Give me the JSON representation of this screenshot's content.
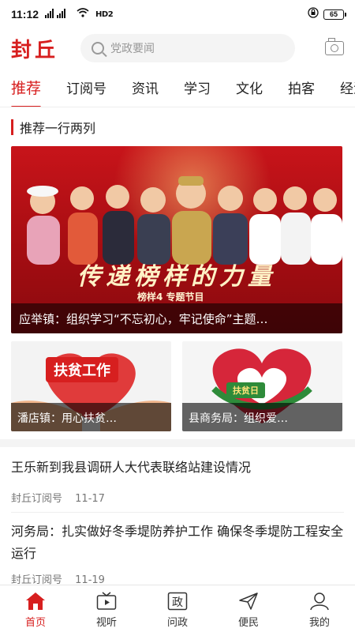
{
  "status_bar": {
    "time": "11:12",
    "signal_text": "HD2",
    "battery": "65"
  },
  "header": {
    "logo": "封丘",
    "search_placeholder": "党政要闻",
    "camera_icon": "camera-icon"
  },
  "tabs": [
    {
      "label": "推荐",
      "active": true
    },
    {
      "label": "订阅号",
      "active": false
    },
    {
      "label": "资讯",
      "active": false
    },
    {
      "label": "学习",
      "active": false
    },
    {
      "label": "文化",
      "active": false
    },
    {
      "label": "拍客",
      "active": false
    },
    {
      "label": "经济",
      "active": false
    }
  ],
  "section": {
    "title": "推荐一行两列"
  },
  "hero": {
    "calligraphy": "传递榜样的力量",
    "subtitle": "榜样4 专题节目",
    "caption": "应举镇：组织学习“不忘初心，牢记使命”主题…"
  },
  "cards": [
    {
      "badge": "扶贫工作",
      "caption": "潘店镇：用心扶贫…"
    },
    {
      "badge": "扶贫日",
      "caption": "县商务局：组织爱…"
    }
  ],
  "news": [
    {
      "title": "王乐新到我县调研人大代表联络站建设情况",
      "source": "封丘订阅号",
      "date": "11-17"
    },
    {
      "title": "河务局：扎实做好冬季堤防养护工作 确保冬季堤防工程安全运行",
      "source": "封丘订阅号",
      "date": "11-19"
    }
  ],
  "bottom_nav": [
    {
      "label": "首页",
      "icon": "home-icon",
      "active": true
    },
    {
      "label": "视听",
      "icon": "tv-icon",
      "active": false
    },
    {
      "label": "问政",
      "icon": "zheng-icon",
      "active": false
    },
    {
      "label": "便民",
      "icon": "send-icon",
      "active": false
    },
    {
      "label": "我的",
      "icon": "user-icon",
      "active": false
    }
  ],
  "colors": {
    "accent": "#d71f1f"
  }
}
